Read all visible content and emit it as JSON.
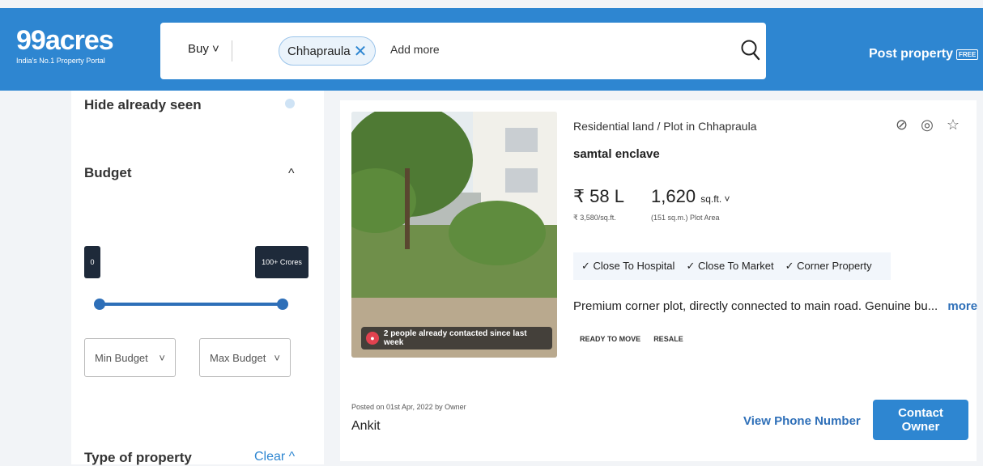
{
  "header": {
    "logo_main": "99acres",
    "logo_tag": "India's No.1 Property Portal",
    "buy_label": "Buy ˅",
    "search_chip": "Chhapraula",
    "add_more": "Add more",
    "post_property": "Post property",
    "free_badge": "FREE"
  },
  "sidebar": {
    "hide_seen": "Hide already seen",
    "budget_title": "Budget",
    "min_tag": "0",
    "max_tag": "100+ Crores",
    "min_select": "Min Budget",
    "max_select": "Max Budget",
    "type_title": "Type of property",
    "clear": "Clear ^"
  },
  "listing": {
    "type": "Residential land / Plot in Chhapraula",
    "name": "samtal enclave",
    "price": "₹ 58 L",
    "price_per": "₹ 3,580/sq.ft.",
    "area": "1,620",
    "area_unit": "sq.ft. ˅",
    "area_sub": "(151 sq.m.) Plot Area",
    "features": [
      "✓ Close To Hospital",
      "✓ Close To Market",
      "✓ Corner Property"
    ],
    "description": "Premium corner plot, directly connected to main road. Genuine bu...",
    "more": "more",
    "tags": [
      "READY TO MOVE",
      "RESALE"
    ],
    "contact_badge": "2 people already contacted since last week",
    "posted": "Posted on 01st Apr, 2022 by Owner",
    "owner": "Ankit",
    "view_phone": "View Phone Number",
    "contact_owner": "Contact Owner"
  },
  "colors": {
    "brand": "#2e86d1",
    "slider": "#2e6fb8"
  }
}
